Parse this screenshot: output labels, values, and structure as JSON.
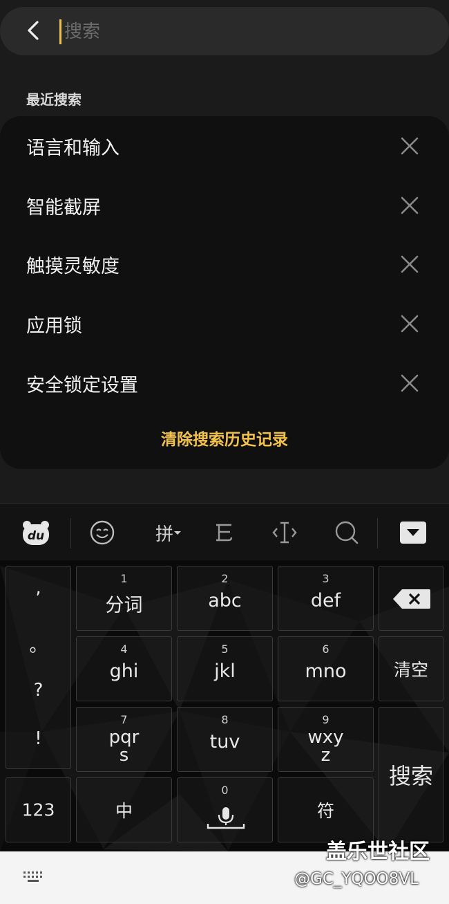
{
  "search": {
    "placeholder": "搜索",
    "value": ""
  },
  "recent": {
    "title": "最近搜索",
    "items": [
      "语言和输入",
      "智能截屏",
      "触摸灵敏度",
      "应用锁",
      "安全锁定设置"
    ],
    "clear_label": "清除搜索历史记录"
  },
  "keyboard": {
    "toolbar": {
      "pinyin_label": "拼",
      "logo_text": "du"
    },
    "punctuation": [
      ",",
      "。",
      "?",
      "!"
    ],
    "keys": [
      {
        "num": "1",
        "label": "分词"
      },
      {
        "num": "2",
        "label": "abc"
      },
      {
        "num": "3",
        "label": "def"
      },
      {
        "num": "4",
        "label": "ghi"
      },
      {
        "num": "5",
        "label": "jkl"
      },
      {
        "num": "6",
        "label": "mno"
      },
      {
        "num": "7",
        "label": "pqr",
        "label2": "s"
      },
      {
        "num": "8",
        "label": "tuv"
      },
      {
        "num": "9",
        "label": "wxy",
        "label2": "z"
      }
    ],
    "clear_label": "清空",
    "search_label": "搜索",
    "num_label": "123",
    "chinese_label": "中",
    "zero_label": "0",
    "symbol_label": "符"
  },
  "watermark": {
    "site": "盖乐世社区",
    "user": "@GC_YQOO8VL"
  },
  "colors": {
    "accent": "#f3c24b",
    "background": "#1b1b1b",
    "card": "#101010"
  }
}
